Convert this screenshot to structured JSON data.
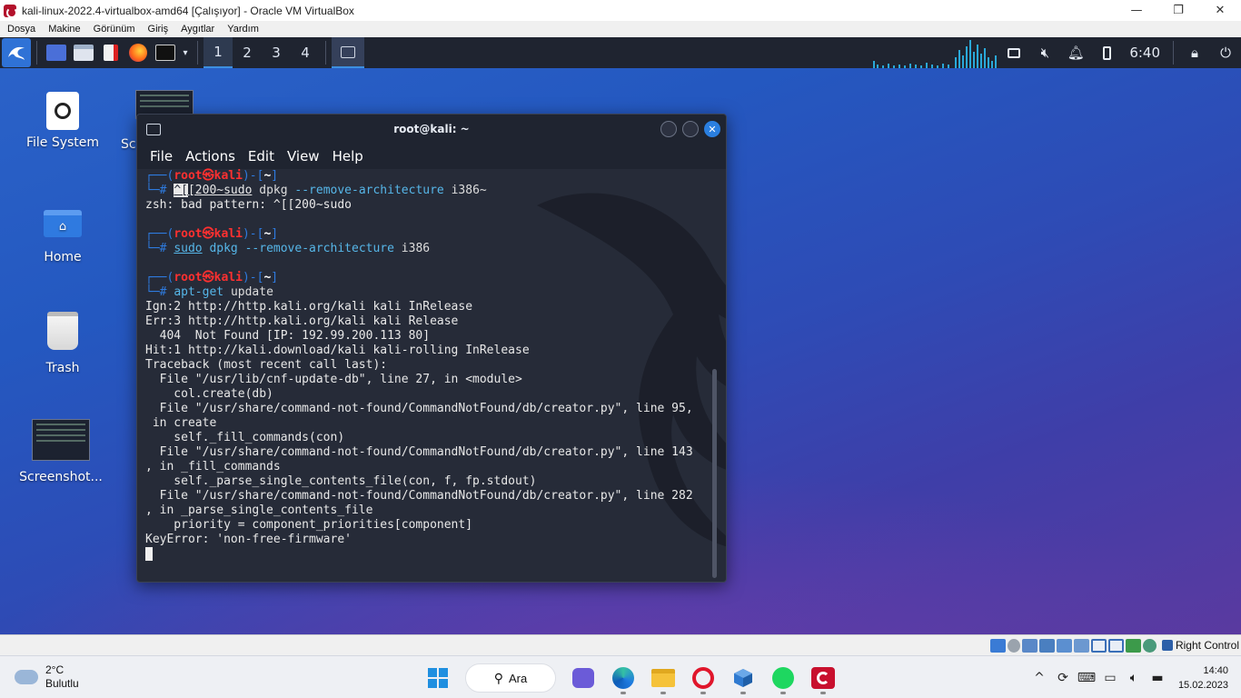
{
  "vbox": {
    "title": "kali-linux-2022.4-virtualbox-amd64 [Çalışıyor] - Oracle VM VirtualBox",
    "controls": {
      "minimize": "—",
      "restore": "❐",
      "close": "✕"
    },
    "menu": [
      "Dosya",
      "Makine",
      "Görünüm",
      "Giriş",
      "Aygıtlar",
      "Yardım"
    ],
    "host_key": "Right Control"
  },
  "kali_panel": {
    "workspaces": [
      "1",
      "2",
      "3",
      "4"
    ],
    "active_workspace": "1",
    "clock": "6:40"
  },
  "desktop": {
    "icons": [
      "File System",
      "Sc",
      "Home",
      "Trash",
      "Screenshot..."
    ]
  },
  "terminal": {
    "title": "root@kali: ~",
    "menu": [
      "File",
      "Actions",
      "Edit",
      "View",
      "Help"
    ],
    "prompt": {
      "open": "┌──(",
      "user": "root",
      "at": "㉿",
      "host": "kali",
      "mid": ")-[",
      "dir": "~",
      "close": "]",
      "hash": "└─#"
    },
    "cmd1_esc": "^[",
    "cmd1_rest": "[200~sudo",
    "cmd1_args": "dpkg",
    "cmd1_flag": "--remove-architecture",
    "cmd1_tail": "i386~",
    "err1": "zsh: bad pattern: ^[[200~sudo",
    "cmd2_sudo": "sudo",
    "cmd2_dpkg": "dpkg",
    "cmd2_flag": "--remove-architecture",
    "cmd2_tail": "i386",
    "cmd3_bin": "apt-get",
    "cmd3_arg": "update",
    "output": [
      "Ign:2 http://http.kali.org/kali kali InRelease",
      "Err:3 http://http.kali.org/kali kali Release",
      "  404  Not Found [IP: 192.99.200.113 80]",
      "Hit:1 http://kali.download/kali kali-rolling InRelease",
      "Traceback (most recent call last):",
      "  File \"/usr/lib/cnf-update-db\", line 27, in <module>",
      "    col.create(db)",
      "  File \"/usr/share/command-not-found/CommandNotFound/db/creator.py\", line 95,",
      " in create",
      "    self._fill_commands(con)",
      "  File \"/usr/share/command-not-found/CommandNotFound/db/creator.py\", line 143",
      ", in _fill_commands",
      "    self._parse_single_contents_file(con, f, fp.stdout)",
      "  File \"/usr/share/command-not-found/CommandNotFound/db/creator.py\", line 282",
      ", in _parse_single_contents_file",
      "    priority = component_priorities[component]",
      "KeyError: 'non-free-firmware'"
    ]
  },
  "win_taskbar": {
    "weather_temp": "2°C",
    "weather_desc": "Bulutlu",
    "search_label": "Ara",
    "time": "14:40",
    "date": "15.02.2023"
  }
}
